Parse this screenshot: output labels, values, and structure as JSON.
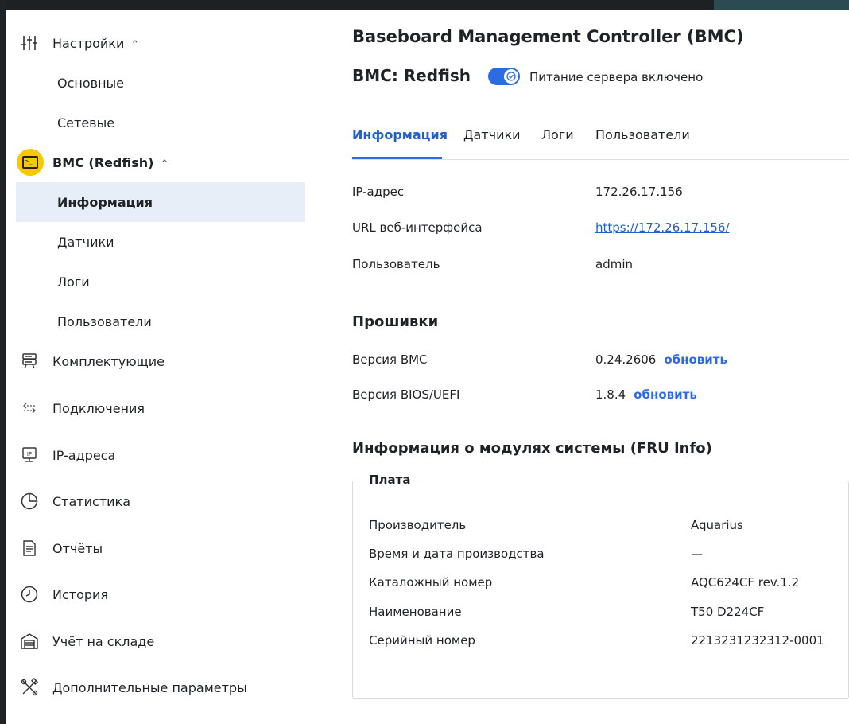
{
  "sidebar": {
    "settings": {
      "label": "Настройки",
      "icon": "sliders-icon"
    },
    "settings_sub": [
      "Основные",
      "Сетевые"
    ],
    "bmc": {
      "label": "BMC (Redfish)",
      "icon": "terminal-icon"
    },
    "bmc_sub": [
      "Информация",
      "Датчики",
      "Логи",
      "Пользователи"
    ],
    "bmc_active": "Информация",
    "items": [
      {
        "label": "Комплектующие",
        "icon": "server-icon"
      },
      {
        "label": "Подключения",
        "icon": "connections-icon"
      },
      {
        "label": "IP-адреса",
        "icon": "ip-monitor-icon"
      },
      {
        "label": "Статистика",
        "icon": "pie-chart-icon"
      },
      {
        "label": "Отчёты",
        "icon": "document-icon"
      },
      {
        "label": "История",
        "icon": "clock-icon"
      },
      {
        "label": "Учёт на складе",
        "icon": "warehouse-icon"
      },
      {
        "label": "Дополнительные параметры",
        "icon": "tools-icon"
      }
    ]
  },
  "header": {
    "title": "Baseboard Management Controller (BMC)",
    "subtitle": "BMC: Redfish",
    "power_label": "Питание сервера включено",
    "power_on": true
  },
  "tabs": [
    "Информация",
    "Датчики",
    "Логи",
    "Пользователи"
  ],
  "active_tab": "Информация",
  "info": {
    "ip_label": "IP-адрес",
    "ip_value": "172.26.17.156",
    "url_label": "URL веб-интерфейса",
    "url_value": "https://172.26.17.156/",
    "user_label": "Пользователь",
    "user_value": "admin"
  },
  "firmware": {
    "title": "Прошивки",
    "bmc_label": "Версия BMC",
    "bmc_value": "0.24.2606",
    "bios_label": "Версия BIOS/UEFI",
    "bios_value": "1.8.4",
    "update_label": "обновить"
  },
  "fru": {
    "title": "Информация о модулях системы (FRU Info)",
    "board_title": "Плата",
    "rows": [
      {
        "label": "Производитель",
        "value": "Aquarius"
      },
      {
        "label": "Время и дата производства",
        "value": "—"
      },
      {
        "label": "Каталожный номер",
        "value": "AQC624CF rev.1.2"
      },
      {
        "label": "Наименование",
        "value": "T50 D224CF"
      },
      {
        "label": "Серийный номер",
        "value": "2213231232312-0001"
      }
    ]
  },
  "colors": {
    "accent": "#2d6be3",
    "active_bg": "#e7eef8",
    "highlight": "#f7c900"
  }
}
